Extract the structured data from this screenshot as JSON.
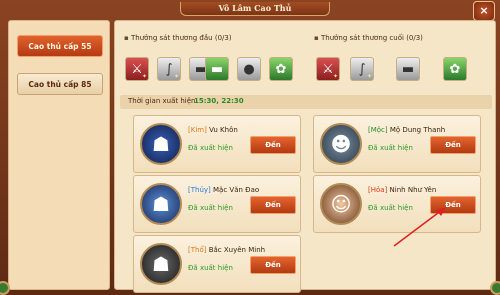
{
  "window": {
    "title": "Võ Lâm Cao Thủ",
    "close_icon": "×"
  },
  "sidebar": {
    "tabs": [
      {
        "label": "Cao thủ cấp 55",
        "active": true
      },
      {
        "label": "Cao thủ cấp 85",
        "active": false
      }
    ]
  },
  "rewards": {
    "first": {
      "label": "Thưởng sát thương đầu",
      "count": "(0/3)",
      "items": [
        {
          "icon": "red-weapon-icon",
          "color": "red"
        },
        {
          "icon": "scroll-icon",
          "color": "gray"
        },
        {
          "icon": "anvil-icon",
          "color": "gray"
        },
        {
          "icon": "anvil-green-icon",
          "color": "green"
        },
        {
          "icon": "orb-icon",
          "color": "gray"
        },
        {
          "icon": "green-gem-icon",
          "color": "green"
        }
      ]
    },
    "last": {
      "label": "Thưởng sát thương cuối",
      "count": "(0/3)",
      "items": [
        {
          "icon": "red-weapon-icon",
          "color": "red"
        },
        {
          "icon": "scroll-icon",
          "color": "gray"
        },
        {
          "icon": "anvil-icon",
          "color": "gray"
        },
        {
          "icon": "green-gem-icon",
          "color": "green"
        }
      ]
    }
  },
  "schedule": {
    "label": "Thời gian xuất hiện:",
    "value": "15:30, 22:30"
  },
  "bosses": [
    {
      "element": "[Kim]",
      "name": "Vu Khôn",
      "status": "Đã xuất hiện",
      "button": "Đến"
    },
    {
      "element": "[Mộc]",
      "name": "Mộ Dung Thanh",
      "status": "Đã xuất hiện",
      "button": "Đến"
    },
    {
      "element": "[Thủy]",
      "name": "Mặc Văn Đao",
      "status": "Đã xuất hiện",
      "button": "Đến"
    },
    {
      "element": "[Hỏa]",
      "name": "Ninh Như Yên",
      "status": "Đã xuất hiện",
      "button": "Đến"
    },
    {
      "element": "[Thổ]",
      "name": "Bắc Xuyên Minh",
      "status": "Đã xuất hiện",
      "button": "Đến"
    }
  ],
  "colors": {
    "accent": "#e2642e",
    "appeared": "#2a9a2a",
    "arrow": "#e02020"
  }
}
